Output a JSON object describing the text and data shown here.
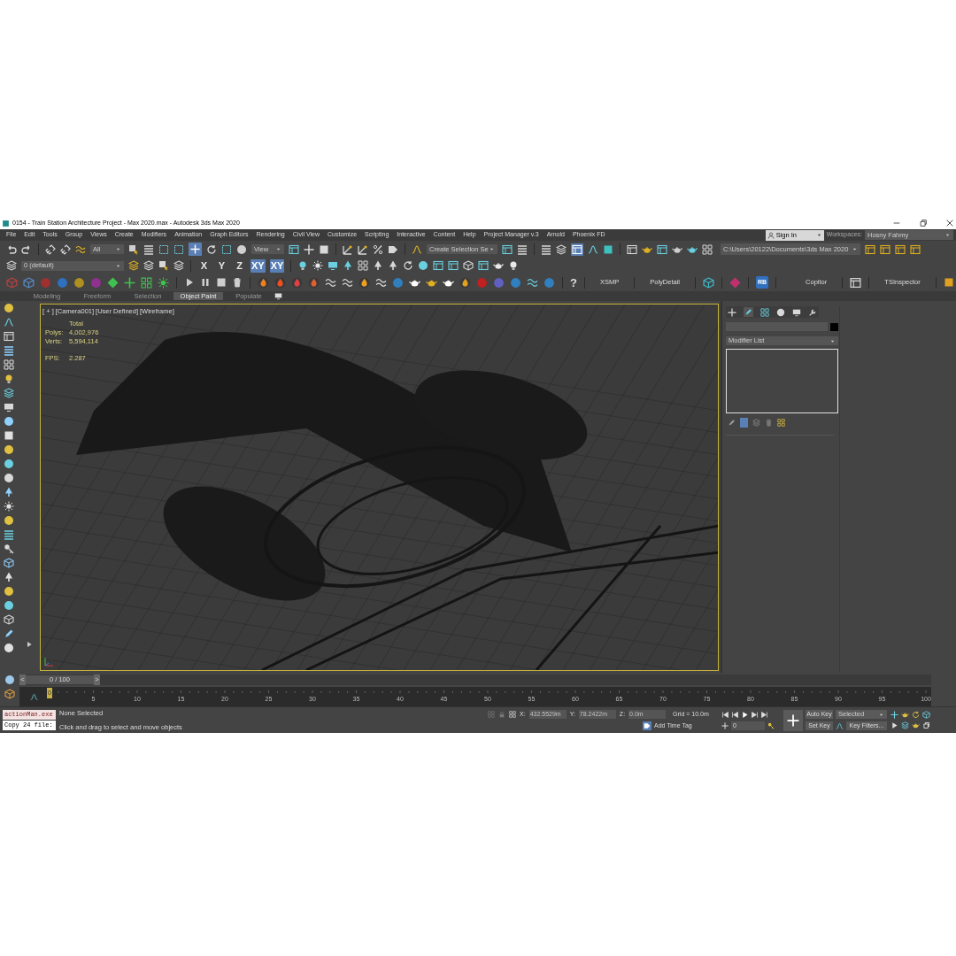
{
  "window": {
    "title": "0154 - Train Station Architecture Project - Max 2020.max - Autodesk 3ds Max 2020"
  },
  "menu": [
    "File",
    "Edit",
    "Tools",
    "Group",
    "Views",
    "Create",
    "Modifiers",
    "Animation",
    "Graph Editors",
    "Rendering",
    "Civil View",
    "Customize",
    "Scripting",
    "Interactive",
    "Content",
    "Help",
    "Project Manager v.3",
    "Arnold",
    "Phoenix FD"
  ],
  "account": {
    "sign_in": "Sign In",
    "workspaces_label": "Workspaces:",
    "workspace": "Hosny Fahmy"
  },
  "main_toolbar": {
    "selection_filter": "All",
    "reference_coordinate": "View",
    "named_selection": "Create Selection Se",
    "project_path": "C:\\Users\\20122\\Documents\\3ds Max 2020"
  },
  "layer_toolbar": {
    "layer": "0 (default)",
    "axes": [
      {
        "label": "X",
        "selected": false
      },
      {
        "label": "Y",
        "selected": false
      },
      {
        "label": "Z",
        "selected": false
      },
      {
        "label": "XY",
        "selected": true
      },
      {
        "label": "XY",
        "selected": true
      }
    ]
  },
  "plugin_toolbar": {
    "help": "?",
    "buttons": [
      {
        "kind": "text",
        "label": "XSMP"
      },
      {
        "kind": "text",
        "label": "PolyDetail"
      },
      {
        "kind": "badge",
        "label": "RB"
      },
      {
        "kind": "text",
        "label": "Copitor"
      },
      {
        "kind": "text",
        "label": "TSInspector"
      }
    ]
  },
  "ribbon_tabs": [
    {
      "label": "Modeling",
      "selected": false
    },
    {
      "label": "Freeform",
      "selected": false
    },
    {
      "label": "Selection",
      "selected": false
    },
    {
      "label": "Object Paint",
      "selected": true
    },
    {
      "label": "Populate",
      "selected": false
    }
  ],
  "viewport": {
    "labels": [
      "[ + ]",
      "[Camera001]",
      "[User Defined]",
      "[Wireframe]"
    ],
    "stats_heading": "Total",
    "stats": [
      {
        "label": "Polys:",
        "value": "4,002,976"
      },
      {
        "label": "Verts:",
        "value": "5,594,114"
      }
    ],
    "fps_label": "FPS:",
    "fps": "2.287"
  },
  "command_panel": {
    "modifier_list": "Modifier List"
  },
  "time_slider": {
    "level": 0,
    "prev": "<",
    "position": "0 / 100",
    "next": ">"
  },
  "ruler": [
    "0",
    "5",
    "10",
    "15",
    "20",
    "25",
    "30",
    "35",
    "40",
    "45",
    "50",
    "55",
    "60",
    "65",
    "70",
    "75",
    "80",
    "85",
    "90",
    "95",
    "100"
  ],
  "maxscript": [
    "actionMan.exe",
    "Copy 24 file:"
  ],
  "status": {
    "selection": "None Selected",
    "prompt": "Click and drag to select and move objects",
    "coords": [
      {
        "label": "X:",
        "value": "432.5529m"
      },
      {
        "label": "Y:",
        "value": "78.2422m"
      },
      {
        "label": "Z:",
        "value": "0.0m"
      }
    ],
    "grid": "Grid = 10.0m",
    "time_tag": "Add Time Tag",
    "frame": "0",
    "auto_key": "Auto Key",
    "key_mode": "Selected",
    "set_key": "Set Key",
    "key_filters": "Key Filters..."
  }
}
